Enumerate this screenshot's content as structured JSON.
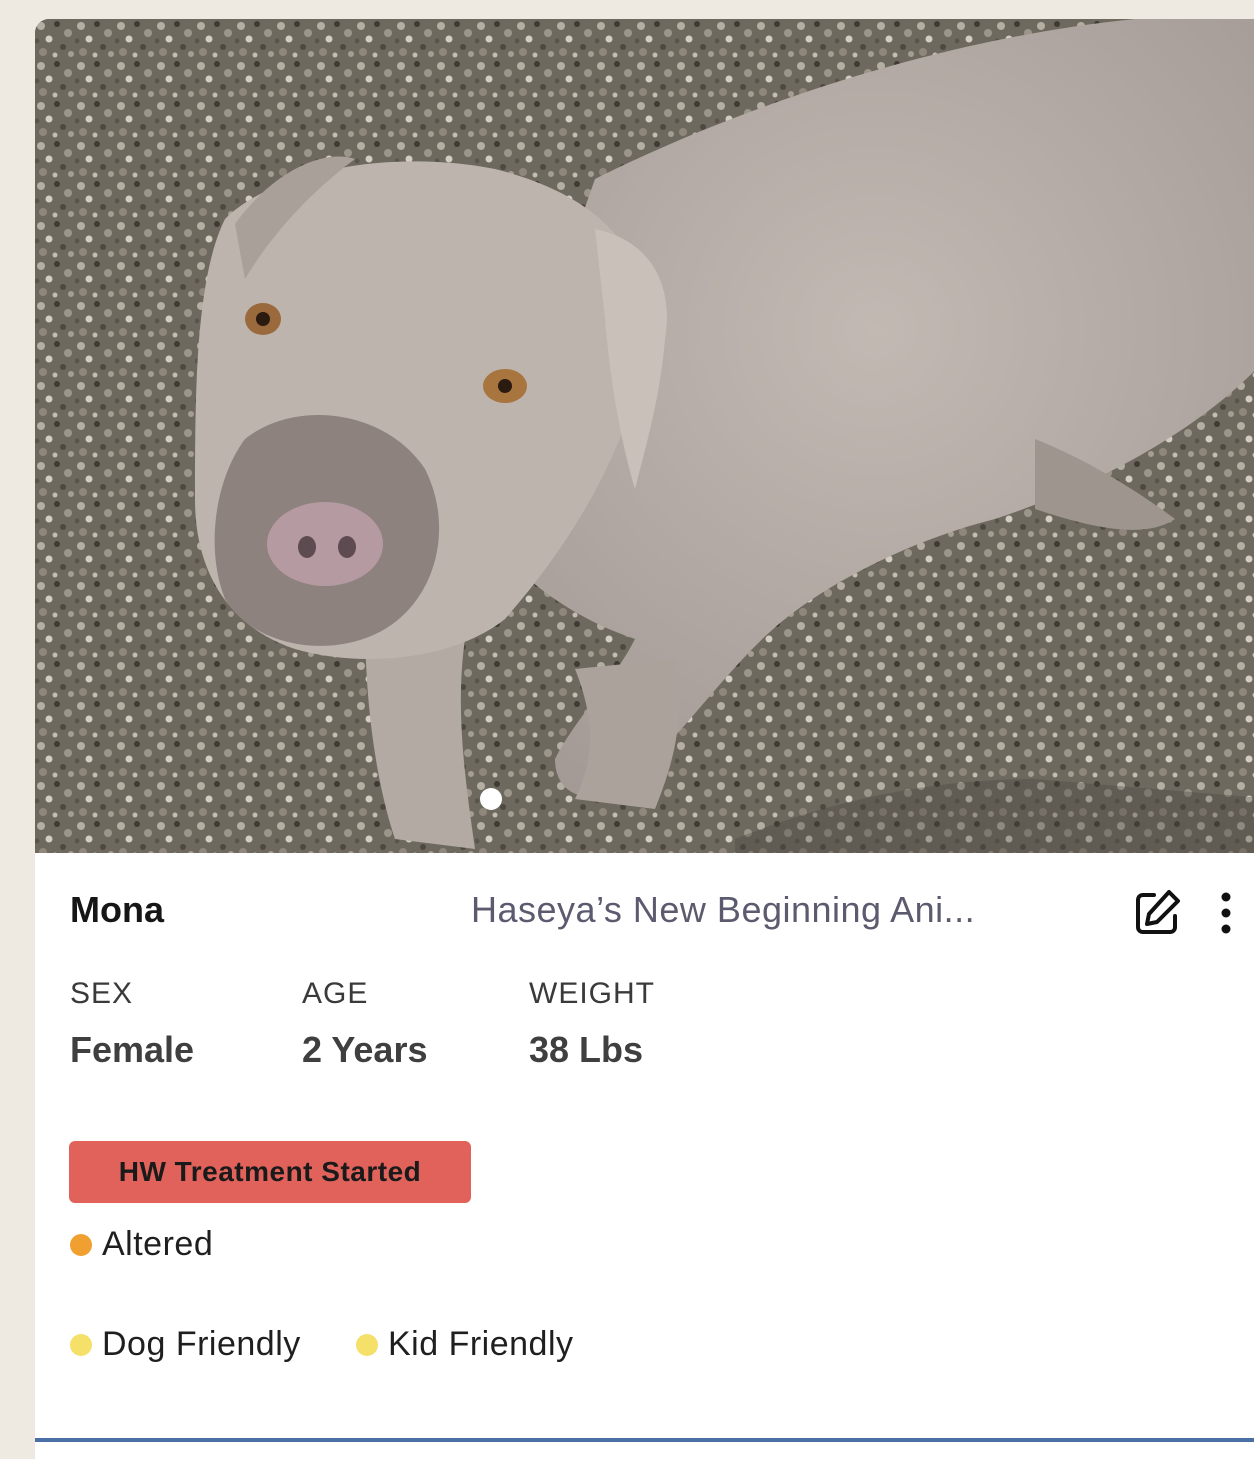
{
  "animal": {
    "name": "Mona",
    "organization": "Haseya’s New Beginning Ani..."
  },
  "stats": [
    {
      "label": "SEX",
      "value": "Female"
    },
    {
      "label": "AGE",
      "value": "2 Years"
    },
    {
      "label": "WEIGHT",
      "value": "38 Lbs"
    }
  ],
  "badge": {
    "label": "HW Treatment Started",
    "color": "#E0625B"
  },
  "tags": [
    {
      "label": "Altered",
      "color": "#F0A030"
    },
    {
      "label": "Dog Friendly",
      "color": "#F5E06A"
    },
    {
      "label": "Kid Friendly",
      "color": "#F5E06A"
    }
  ],
  "icons": {
    "edit": "edit-icon",
    "more": "more-vertical-icon"
  },
  "carousel": {
    "current": 1,
    "total": 1
  }
}
